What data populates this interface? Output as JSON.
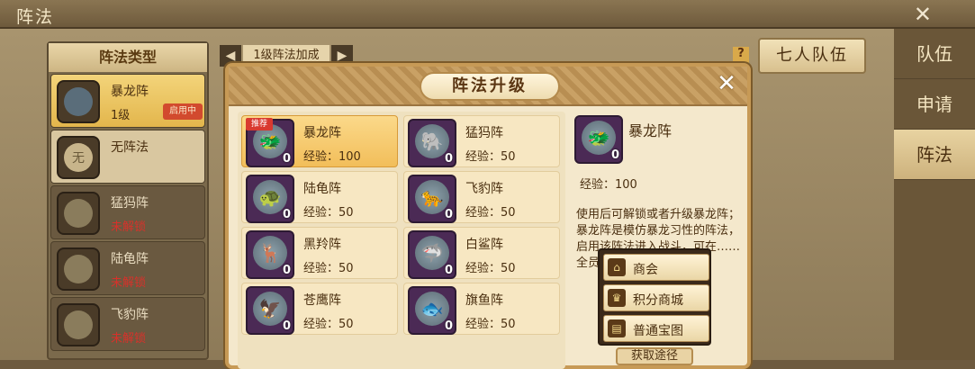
{
  "window": {
    "title": "阵法",
    "close_glyph": "✕"
  },
  "left_panel": {
    "header": "阵法类型",
    "items": [
      {
        "name": "暴龙阵",
        "sub": "1级",
        "badge": "启用中",
        "state": "active"
      },
      {
        "name": "无阵法",
        "sub": "",
        "badge": "",
        "state": "plain",
        "icon_text": "无"
      },
      {
        "name": "猛犸阵",
        "sub": "未解锁",
        "state": "locked"
      },
      {
        "name": "陆龟阵",
        "sub": "未解锁",
        "state": "locked"
      },
      {
        "name": "飞豹阵",
        "sub": "未解锁",
        "state": "locked"
      }
    ]
  },
  "mid_tabs": {
    "prev": "◀",
    "label": "1级阵法加成",
    "next": "▶",
    "help": "?"
  },
  "team_button": "七人队伍",
  "side_tabs": [
    {
      "label": "队伍",
      "active": false
    },
    {
      "label": "申请",
      "active": false
    },
    {
      "label": "阵法",
      "active": true
    }
  ],
  "modal": {
    "title": "阵法升级",
    "close": "✕",
    "cards": [
      {
        "name": "暴龙阵",
        "xp": "经验：100",
        "count": "0",
        "tag": "推荐",
        "selected": true,
        "emoji": "🐲"
      },
      {
        "name": "猛犸阵",
        "xp": "经验：50",
        "count": "0",
        "selected": false,
        "emoji": "🐘"
      },
      {
        "name": "陆龟阵",
        "xp": "经验：50",
        "count": "0",
        "selected": false,
        "emoji": "🐢"
      },
      {
        "name": "飞豹阵",
        "xp": "经验：50",
        "count": "0",
        "selected": false,
        "emoji": "🐆"
      },
      {
        "name": "黑羚阵",
        "xp": "经验：50",
        "count": "0",
        "selected": false,
        "emoji": "🦌"
      },
      {
        "name": "白鲨阵",
        "xp": "经验：50",
        "count": "0",
        "selected": false,
        "emoji": "🦈"
      },
      {
        "name": "苍鹰阵",
        "xp": "经验：50",
        "count": "0",
        "selected": false,
        "emoji": "🦅"
      },
      {
        "name": "旗鱼阵",
        "xp": "经验：50",
        "count": "0",
        "selected": false,
        "emoji": "🐟"
      }
    ],
    "detail": {
      "name": "暴龙阵",
      "count": "0",
      "xp": "经验：100",
      "desc": "使用后可解锁或者升级暴龙阵；暴龙阵是模仿暴龙习性的阵法，启用该阵法进入战斗，可在……全员伤害……"
    }
  },
  "popup": {
    "items": [
      {
        "label": "商会",
        "icon": "shop-icon",
        "glyph": "⌂"
      },
      {
        "label": "积分商城",
        "icon": "trophy-icon",
        "glyph": "♛"
      },
      {
        "label": "普通宝图",
        "icon": "map-icon",
        "glyph": "▤"
      }
    ]
  },
  "get_button": "获取途径"
}
